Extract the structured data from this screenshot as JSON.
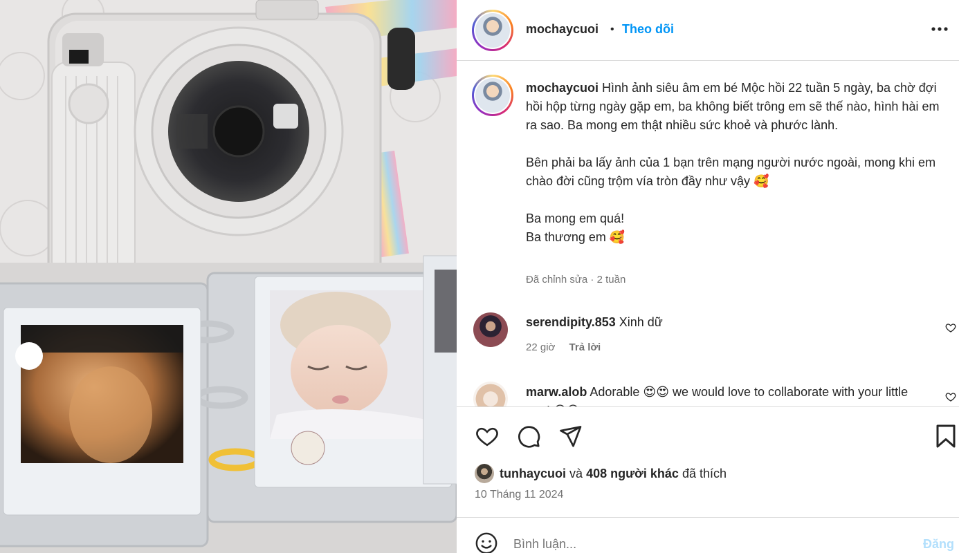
{
  "post": {
    "author": "mochaycuoi",
    "separator": "•",
    "follow_label": "Theo dõi",
    "more_icon": "more-horizontal-icon"
  },
  "caption": {
    "author": "mochaycuoi",
    "text": "Hình ảnh siêu âm em bé Mộc hồi 22 tuần 5 ngày, ba chờ đợi hồi hộp từng ngày gặp em, ba không biết trông em sẽ thế nào, hình hài em ra sao. Ba mong em thật nhiều sức khoẻ và phước lành.\n\nBên phải ba lấy ảnh của 1 bạn trên mạng người nước ngoài, mong khi em chào đời cũng trộm vía tròn đầy như vậy 🥰\n\nBa mong em quá!\nBa thương em 🥰",
    "meta": "Đã chỉnh sửa · 2 tuần"
  },
  "comments": [
    {
      "user": "serendipity.853",
      "text": "Xinh dữ",
      "time": "22 giờ",
      "reply_label": "Trả lời"
    },
    {
      "user": "marw.alob",
      "text": "Adorable 😍😍 we would love to collaborate with your little one! 😍😍"
    }
  ],
  "likes": {
    "user": "tunhaycuoi",
    "connector": "và",
    "others": "408 người khác",
    "suffix": "đã thích"
  },
  "date": "10 Tháng 11 2024",
  "comment_box": {
    "placeholder": "Bình luận...",
    "post_label": "Đăng"
  },
  "colors": {
    "accent": "#0095f6",
    "muted": "#737373",
    "border": "#dbdbdb"
  }
}
